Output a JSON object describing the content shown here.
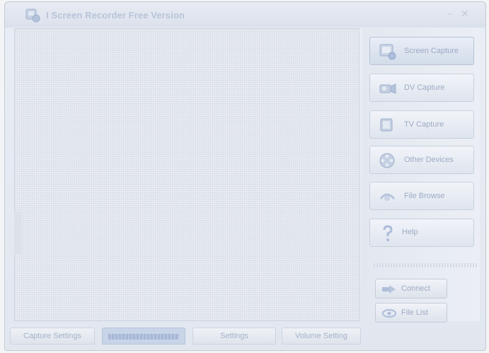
{
  "window": {
    "title": "I Screen Recorder Free Version",
    "minimize_glyph": "–",
    "close_glyph": "✕"
  },
  "sidebar": {
    "buttons": [
      {
        "label": "Screen Capture",
        "icon": "screen-capture-icon"
      },
      {
        "label": "DV Capture",
        "icon": "dv-camera-icon"
      },
      {
        "label": "TV Capture",
        "icon": "tv-icon"
      },
      {
        "label": "Other Devices",
        "icon": "film-reel-icon"
      },
      {
        "label": "File Browse",
        "icon": "file-browse-icon"
      },
      {
        "label": "Help",
        "icon": "help-icon"
      }
    ],
    "connect_label": "Connect",
    "file_list_label": "File List"
  },
  "tabs": [
    {
      "label": "Capture Settings"
    },
    {
      "label": ""
    },
    {
      "label": "Settings"
    },
    {
      "label": "Volume Setting"
    }
  ],
  "colors": {
    "window_bg": "#e5e9f0",
    "title_text": "#b8c4d8",
    "button_text": "#9eabc4",
    "selected_tab": "#c8d4e8"
  }
}
